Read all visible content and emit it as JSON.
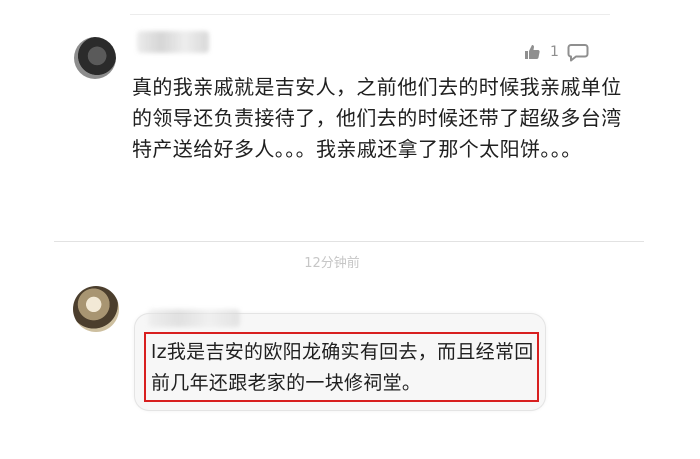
{
  "comment": {
    "like_count": "1",
    "text": "真的我亲戚就是吉安人，之前他们去的时候我亲戚单位的领导还负责接待了，他们去的时候还带了超级多台湾特产送给好多人。。。我亲戚还拿了那个太阳饼。。。"
  },
  "reply": {
    "timestamp": "12分钟前",
    "text": "lz我是吉安的欧阳龙确实有回去，而且经常回前几年还跟老家的一块修祠堂。"
  },
  "icons": {
    "like": "thumbs-up-icon",
    "reply": "comment-bubble-icon"
  },
  "colors": {
    "highlight": "#d81f1f",
    "muted": "#8f8f8f",
    "timestamp": "#c6c6c6",
    "reply_background": "#f7f7f7"
  }
}
